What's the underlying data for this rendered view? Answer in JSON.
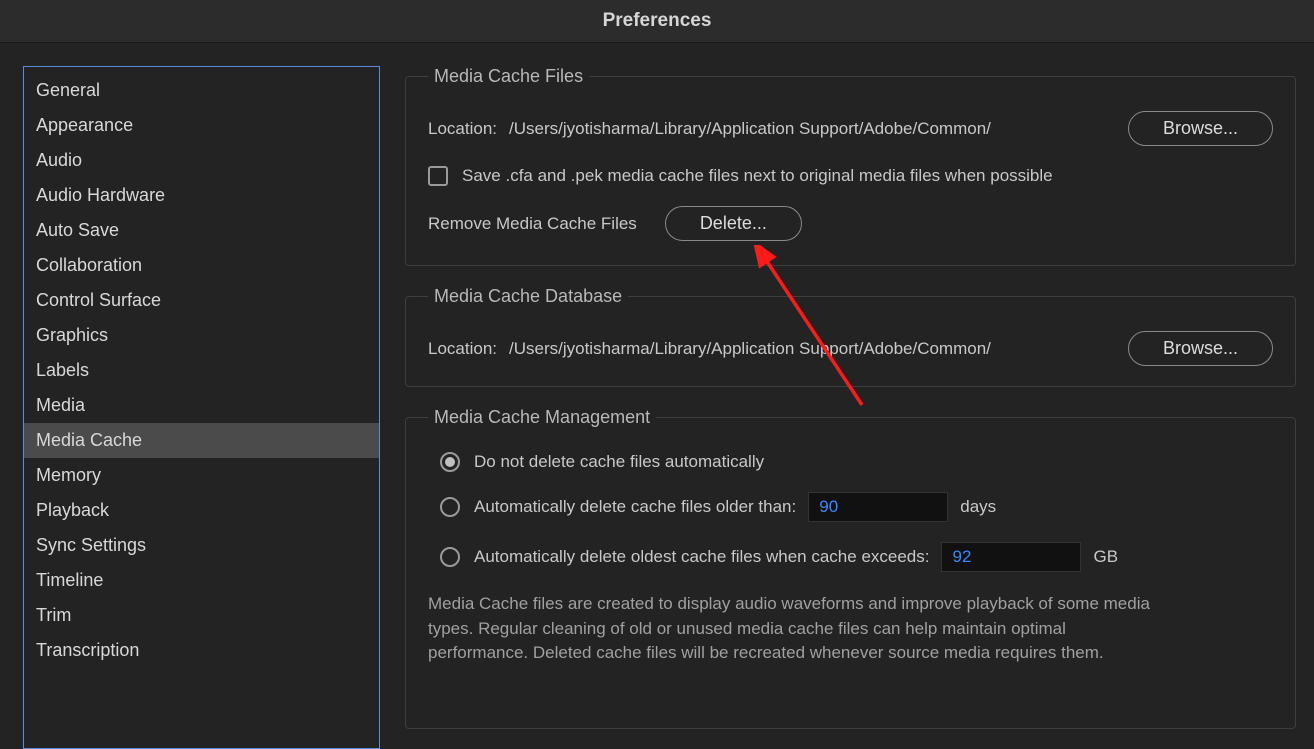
{
  "window": {
    "title": "Preferences"
  },
  "sidebar": {
    "items": [
      {
        "label": "General"
      },
      {
        "label": "Appearance"
      },
      {
        "label": "Audio"
      },
      {
        "label": "Audio Hardware"
      },
      {
        "label": "Auto Save"
      },
      {
        "label": "Collaboration"
      },
      {
        "label": "Control Surface"
      },
      {
        "label": "Graphics"
      },
      {
        "label": "Labels"
      },
      {
        "label": "Media"
      },
      {
        "label": "Media Cache"
      },
      {
        "label": "Memory"
      },
      {
        "label": "Playback"
      },
      {
        "label": "Sync Settings"
      },
      {
        "label": "Timeline"
      },
      {
        "label": "Trim"
      },
      {
        "label": "Transcription"
      }
    ],
    "selected_index": 10
  },
  "cacheFiles": {
    "legend": "Media Cache Files",
    "location_label": "Location:",
    "location_path": "/Users/jyotisharma/Library/Application Support/Adobe/Common/",
    "browse_label": "Browse...",
    "save_checkbox_label": "Save .cfa and .pek media cache files next to original media files when possible",
    "save_checkbox_checked": false,
    "remove_label": "Remove Media Cache Files",
    "delete_label": "Delete..."
  },
  "cacheDb": {
    "legend": "Media Cache Database",
    "location_label": "Location:",
    "location_path": "/Users/jyotisharma/Library/Application Support/Adobe/Common/",
    "browse_label": "Browse..."
  },
  "cacheMgmt": {
    "legend": "Media Cache Management",
    "opt_none": "Do not delete cache files automatically",
    "opt_older_prefix": "Automatically delete cache files older than:",
    "opt_older_value": "90",
    "opt_older_unit": "days",
    "opt_exceeds_prefix": "Automatically delete oldest cache files when cache exceeds:",
    "opt_exceeds_value": "92",
    "opt_exceeds_unit": "GB",
    "selected_option": "none",
    "description": "Media Cache files are created to display audio waveforms and improve playback of some media types.  Regular cleaning of old or unused media cache files can help maintain optimal performance. Deleted cache files will be recreated whenever source media requires them."
  }
}
